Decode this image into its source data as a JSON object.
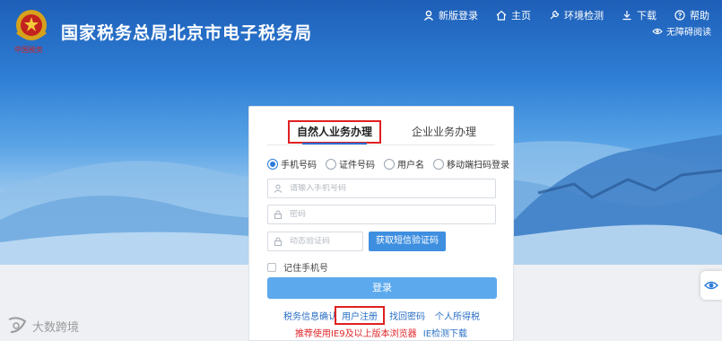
{
  "header": {
    "title": "国家税务总局北京市电子税务局",
    "emblem_caption": "中国税务",
    "nav": [
      {
        "label": "新版登录",
        "icon": "user-icon"
      },
      {
        "label": "主页",
        "icon": "home-icon"
      },
      {
        "label": "环境检测",
        "icon": "wrench-icon"
      },
      {
        "label": "下载",
        "icon": "download-icon"
      },
      {
        "label": "帮助",
        "icon": "help-icon"
      }
    ],
    "accessibility": "无障碍阅读"
  },
  "login": {
    "tabs": [
      "自然人业务办理",
      "企业业务办理"
    ],
    "active_tab": "自然人业务办理",
    "login_types": [
      "手机号码",
      "证件号码",
      "用户名",
      "移动端扫码登录"
    ],
    "selected_type": "手机号码",
    "phone_placeholder": "请输入手机号码",
    "password_placeholder": "密码",
    "code_placeholder": "动态验证码",
    "sms_button": "获取短信验证码",
    "remember_label": "记住手机号",
    "login_button": "登录",
    "links": [
      "税务信息确认",
      "用户注册",
      "找回密码",
      "个人所得税"
    ],
    "notice": "推荐使用IE9及以上版本浏览器",
    "ie_check_link": "IE检测下载"
  },
  "watermark": "大数跨境",
  "colors": {
    "brand_blue": "#2b6fd0",
    "button_blue": "#5da9ee",
    "highlight_red": "#e02020",
    "link_blue": "#2a6fc4"
  }
}
